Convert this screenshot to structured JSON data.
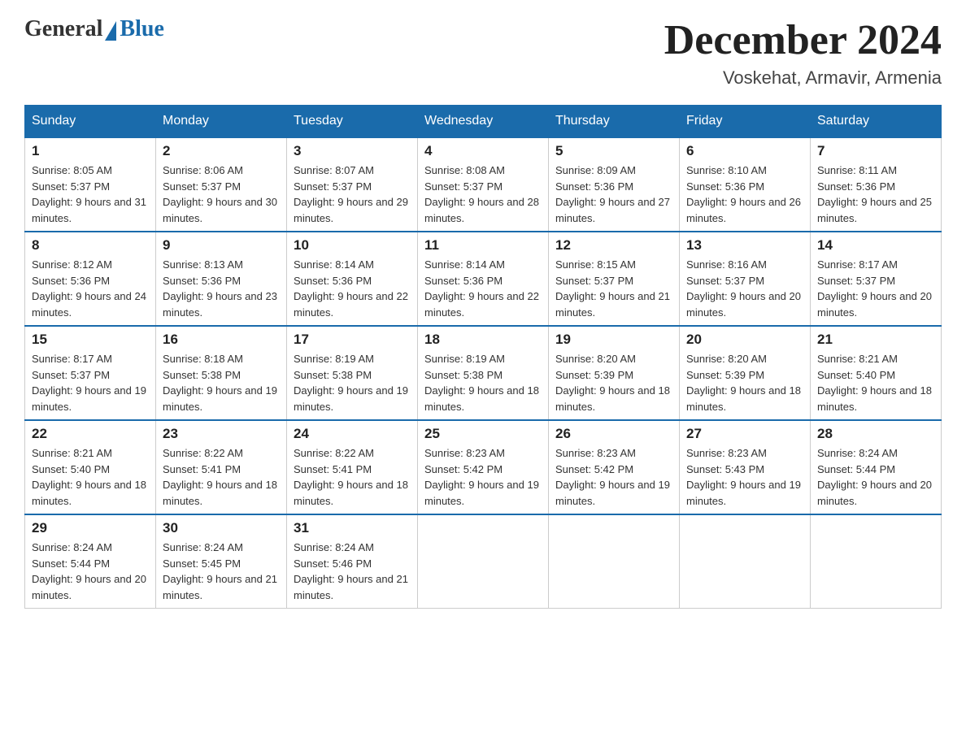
{
  "logo": {
    "general": "General",
    "blue": "Blue"
  },
  "title": {
    "month_year": "December 2024",
    "location": "Voskehat, Armavir, Armenia"
  },
  "headers": [
    "Sunday",
    "Monday",
    "Tuesday",
    "Wednesday",
    "Thursday",
    "Friday",
    "Saturday"
  ],
  "weeks": [
    [
      {
        "day": "1",
        "sunrise": "8:05 AM",
        "sunset": "5:37 PM",
        "daylight": "9 hours and 31 minutes."
      },
      {
        "day": "2",
        "sunrise": "8:06 AM",
        "sunset": "5:37 PM",
        "daylight": "9 hours and 30 minutes."
      },
      {
        "day": "3",
        "sunrise": "8:07 AM",
        "sunset": "5:37 PM",
        "daylight": "9 hours and 29 minutes."
      },
      {
        "day": "4",
        "sunrise": "8:08 AM",
        "sunset": "5:37 PM",
        "daylight": "9 hours and 28 minutes."
      },
      {
        "day": "5",
        "sunrise": "8:09 AM",
        "sunset": "5:36 PM",
        "daylight": "9 hours and 27 minutes."
      },
      {
        "day": "6",
        "sunrise": "8:10 AM",
        "sunset": "5:36 PM",
        "daylight": "9 hours and 26 minutes."
      },
      {
        "day": "7",
        "sunrise": "8:11 AM",
        "sunset": "5:36 PM",
        "daylight": "9 hours and 25 minutes."
      }
    ],
    [
      {
        "day": "8",
        "sunrise": "8:12 AM",
        "sunset": "5:36 PM",
        "daylight": "9 hours and 24 minutes."
      },
      {
        "day": "9",
        "sunrise": "8:13 AM",
        "sunset": "5:36 PM",
        "daylight": "9 hours and 23 minutes."
      },
      {
        "day": "10",
        "sunrise": "8:14 AM",
        "sunset": "5:36 PM",
        "daylight": "9 hours and 22 minutes."
      },
      {
        "day": "11",
        "sunrise": "8:14 AM",
        "sunset": "5:36 PM",
        "daylight": "9 hours and 22 minutes."
      },
      {
        "day": "12",
        "sunrise": "8:15 AM",
        "sunset": "5:37 PM",
        "daylight": "9 hours and 21 minutes."
      },
      {
        "day": "13",
        "sunrise": "8:16 AM",
        "sunset": "5:37 PM",
        "daylight": "9 hours and 20 minutes."
      },
      {
        "day": "14",
        "sunrise": "8:17 AM",
        "sunset": "5:37 PM",
        "daylight": "9 hours and 20 minutes."
      }
    ],
    [
      {
        "day": "15",
        "sunrise": "8:17 AM",
        "sunset": "5:37 PM",
        "daylight": "9 hours and 19 minutes."
      },
      {
        "day": "16",
        "sunrise": "8:18 AM",
        "sunset": "5:38 PM",
        "daylight": "9 hours and 19 minutes."
      },
      {
        "day": "17",
        "sunrise": "8:19 AM",
        "sunset": "5:38 PM",
        "daylight": "9 hours and 19 minutes."
      },
      {
        "day": "18",
        "sunrise": "8:19 AM",
        "sunset": "5:38 PM",
        "daylight": "9 hours and 18 minutes."
      },
      {
        "day": "19",
        "sunrise": "8:20 AM",
        "sunset": "5:39 PM",
        "daylight": "9 hours and 18 minutes."
      },
      {
        "day": "20",
        "sunrise": "8:20 AM",
        "sunset": "5:39 PM",
        "daylight": "9 hours and 18 minutes."
      },
      {
        "day": "21",
        "sunrise": "8:21 AM",
        "sunset": "5:40 PM",
        "daylight": "9 hours and 18 minutes."
      }
    ],
    [
      {
        "day": "22",
        "sunrise": "8:21 AM",
        "sunset": "5:40 PM",
        "daylight": "9 hours and 18 minutes."
      },
      {
        "day": "23",
        "sunrise": "8:22 AM",
        "sunset": "5:41 PM",
        "daylight": "9 hours and 18 minutes."
      },
      {
        "day": "24",
        "sunrise": "8:22 AM",
        "sunset": "5:41 PM",
        "daylight": "9 hours and 18 minutes."
      },
      {
        "day": "25",
        "sunrise": "8:23 AM",
        "sunset": "5:42 PM",
        "daylight": "9 hours and 19 minutes."
      },
      {
        "day": "26",
        "sunrise": "8:23 AM",
        "sunset": "5:42 PM",
        "daylight": "9 hours and 19 minutes."
      },
      {
        "day": "27",
        "sunrise": "8:23 AM",
        "sunset": "5:43 PM",
        "daylight": "9 hours and 19 minutes."
      },
      {
        "day": "28",
        "sunrise": "8:24 AM",
        "sunset": "5:44 PM",
        "daylight": "9 hours and 20 minutes."
      }
    ],
    [
      {
        "day": "29",
        "sunrise": "8:24 AM",
        "sunset": "5:44 PM",
        "daylight": "9 hours and 20 minutes."
      },
      {
        "day": "30",
        "sunrise": "8:24 AM",
        "sunset": "5:45 PM",
        "daylight": "9 hours and 21 minutes."
      },
      {
        "day": "31",
        "sunrise": "8:24 AM",
        "sunset": "5:46 PM",
        "daylight": "9 hours and 21 minutes."
      },
      null,
      null,
      null,
      null
    ]
  ]
}
